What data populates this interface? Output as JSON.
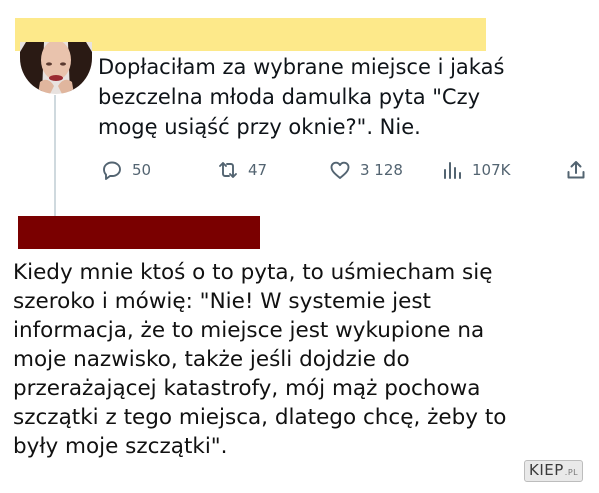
{
  "colors": {
    "redaction_top": "#fde98a",
    "redaction_bottom": "#7a0000",
    "action_gray": "#536471",
    "thread_line": "#cfd9de"
  },
  "tweet": {
    "lines": [
      "Dopłaciłam za wybrane miejsce i jakaś",
      "bezczelna młoda damulka pyta \"Czy",
      "mogę usiąść przy oknie?\". Nie."
    ],
    "actions": {
      "replies": "50",
      "retweets": "47",
      "likes": "3 128",
      "views": "107K"
    }
  },
  "reply": {
    "lines": [
      "Kiedy mnie ktoś o to pyta, to uśmiecham się",
      "szeroko i mówię: \"Nie! W systemie jest",
      "informacja, że to miejsce jest wykupione na",
      "moje nazwisko, także jeśli dojdzie do",
      "przerażającej katastrofy, mój mąż pochowa",
      "szczątki z tego miejsca, dlatego chcę, żeby to",
      "były moje szczątki\"."
    ]
  },
  "watermark": {
    "brand": "KIEP",
    "tld": ".PL"
  }
}
